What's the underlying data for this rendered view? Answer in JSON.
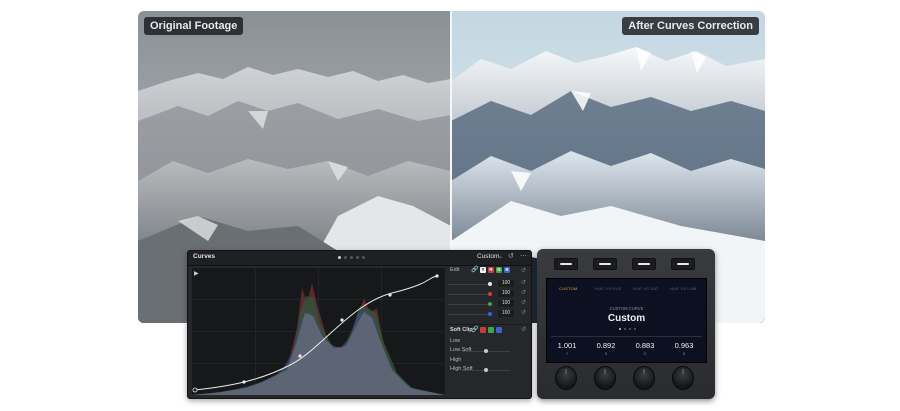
{
  "comparison": {
    "left_label": "Original Footage",
    "right_label": "After Curves Correction"
  },
  "curves_panel": {
    "title": "Curves",
    "preset": "Custom",
    "edit_label": "Edit",
    "channels": [
      {
        "label": "Y",
        "color": "#f2f2f2",
        "text_color": "#222222"
      },
      {
        "label": "R",
        "color": "#d23a3a",
        "text_color": "#ffffff"
      },
      {
        "label": "G",
        "color": "#3aa84a",
        "text_color": "#ffffff"
      },
      {
        "label": "B",
        "color": "#3a62d6",
        "text_color": "#ffffff"
      }
    ],
    "intensity_rows": [
      {
        "dot_color": "#e8e8e8",
        "value": "100"
      },
      {
        "dot_color": "#d23a3a",
        "value": "100"
      },
      {
        "dot_color": "#3aa84a",
        "value": "100"
      },
      {
        "dot_color": "#3a62d6",
        "value": "100"
      }
    ],
    "soft_clip": {
      "label": "Soft Clip",
      "sliders": [
        {
          "label": "Low",
          "position": 0.0
        },
        {
          "label": "Low Soft",
          "position": 0.5
        },
        {
          "label": "High",
          "position": 0.0
        },
        {
          "label": "High Soft",
          "position": 0.5
        }
      ]
    }
  },
  "device": {
    "tabs": [
      "CUSTOM",
      "HUE VS HUE",
      "HUE VS SAT",
      "HUE VS LUM"
    ],
    "active_tab": 0,
    "subtitle": "CUSTOM CURVE",
    "preset": "Custom",
    "values": [
      {
        "value": "1.001",
        "caption": "Y"
      },
      {
        "value": "0.892",
        "caption": "R"
      },
      {
        "value": "0.883",
        "caption": "G"
      },
      {
        "value": "0.963",
        "caption": "B"
      }
    ]
  },
  "colors": {
    "panel_bg": "#26272a",
    "accent_gold": "#d9a942",
    "screen_bg": "#0c1020"
  }
}
